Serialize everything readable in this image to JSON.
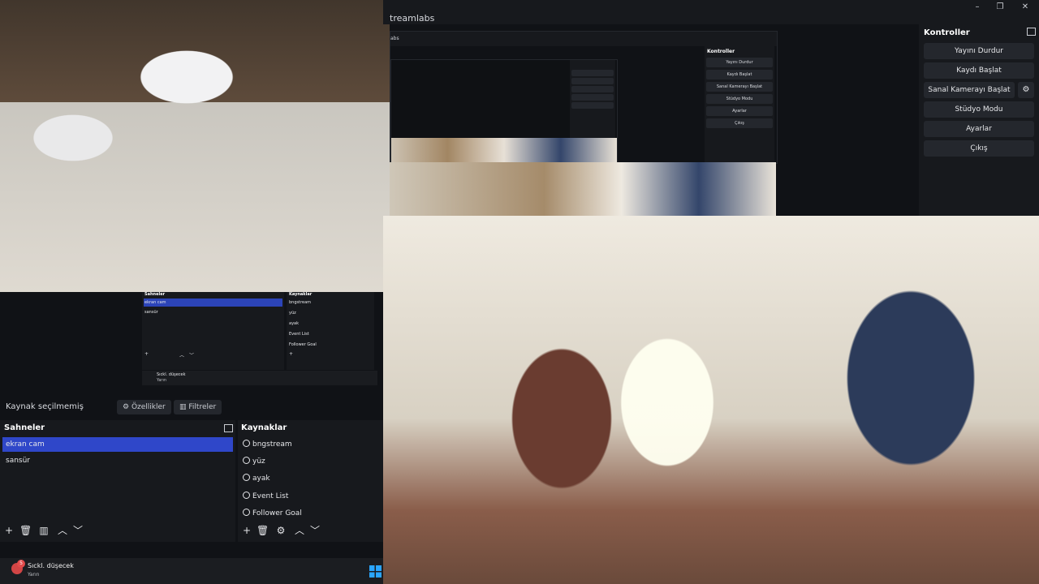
{
  "window": {
    "title": "treamlabs",
    "minimize": "–",
    "maximize": "❐",
    "close": "✕"
  },
  "nested": {
    "title": "abs",
    "controls_title": "Kontroller",
    "controls": [
      "Yayını Durdur",
      "Kaydı Başlat",
      "Sanal Kamerayı Başlat",
      "Stüdyo Modu",
      "Ayarlar",
      "Çıkış"
    ]
  },
  "controls": {
    "title": "Kontroller",
    "buttons": {
      "stop_stream": "Yayını Durdur",
      "start_recording": "Kaydı Başlat",
      "start_virtual_cam": "Sanal Kamerayı Başlat",
      "studio_mode": "Stüdyo Modu",
      "settings": "Ayarlar",
      "exit": "Çıkış"
    },
    "gear_glyph": "⚙"
  },
  "mini": {
    "scenes_title": "Sahneler",
    "sources_title": "Kaynaklar",
    "scenes": [
      "ekran cam",
      "sansür"
    ],
    "sources": [
      "bngstream",
      "yüz",
      "ayak",
      "Event List",
      "Follower Goal"
    ],
    "notif_title": "Sıckl. düşecek",
    "notif_sub": "Yarın"
  },
  "source_bar": {
    "no_source": "Kaynak seçilmemiş",
    "properties": "Özellikler",
    "filters": "Filtreler"
  },
  "scenes": {
    "title": "Sahneler",
    "items": [
      {
        "label": "ekran cam",
        "selected": true
      },
      {
        "label": "sansür",
        "selected": false
      }
    ]
  },
  "sources": {
    "title": "Kaynaklar",
    "items": [
      "bngstream",
      "yüz",
      "ayak",
      "Event List",
      "Follower Goal"
    ]
  },
  "toolbar_glyphs": {
    "add": "+",
    "remove": "🗑",
    "filter": "▥",
    "settings": "⚙",
    "up": "︿",
    "down": "﹀"
  },
  "taskbar": {
    "notification_title": "Sıckl. düşecek",
    "notification_sub": "Yarın",
    "badge": "5"
  },
  "colors": {
    "accent": "#2f47c9",
    "panel": "#17191d",
    "button": "#24272d"
  }
}
